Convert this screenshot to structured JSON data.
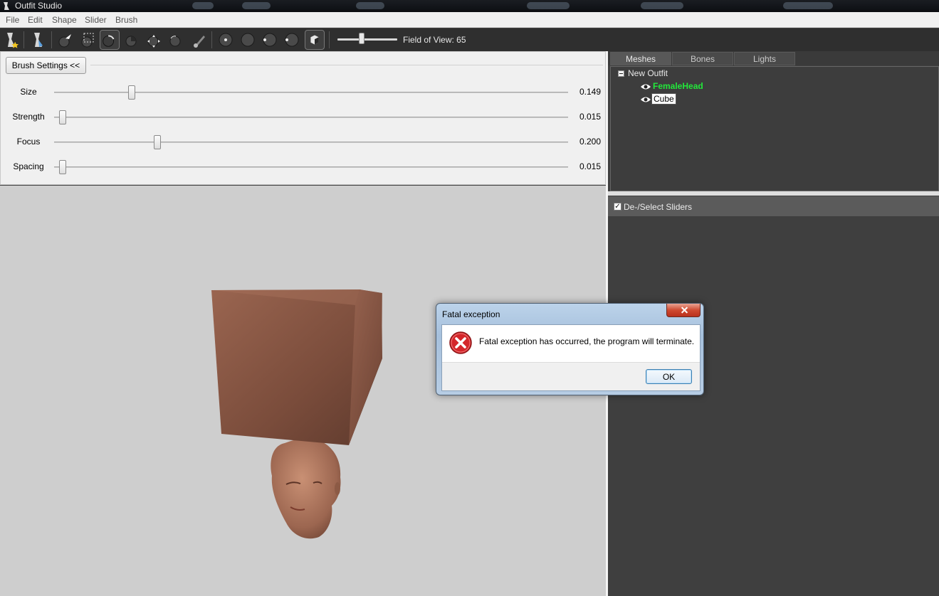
{
  "window": {
    "title": "Outfit Studio"
  },
  "menu": [
    "File",
    "Edit",
    "Shape",
    "Slider",
    "Brush"
  ],
  "toolbar": {
    "fov_label": "Field of View: 65",
    "fov_value": 65,
    "fov_range": [
      10,
      145
    ],
    "icons": [
      "new-project-icon",
      "load-outfit-icon",
      "select-brush-icon",
      "mask-brush-icon",
      "inflate-brush-icon",
      "deflate-brush-icon",
      "move-brush-icon",
      "smooth-brush-icon",
      "weight-brush-icon",
      "vertex-view-icon",
      "shaded-view-icon",
      "wireframe-view-icon",
      "lighting-view-icon",
      "textured-view-icon"
    ],
    "selected_tool": "inflate-brush-icon"
  },
  "brush_settings": {
    "button": "Brush Settings <<",
    "sliders": [
      {
        "label": "Size",
        "value": "0.149",
        "position": 0.149
      },
      {
        "label": "Strength",
        "value": "0.015",
        "position": 0.015
      },
      {
        "label": "Focus",
        "value": "0.200",
        "position": 0.2
      },
      {
        "label": "Spacing",
        "value": "0.015",
        "position": 0.015
      }
    ]
  },
  "tabs": [
    "Meshes",
    "Bones",
    "Lights"
  ],
  "active_tab": "Meshes",
  "tree": {
    "root": "New Outfit",
    "children": [
      "FemaleHead",
      "Cube"
    ],
    "colors": {
      "FemaleHead": "#22e83a",
      "Cube": "#000000"
    }
  },
  "sliders_header": {
    "checkbox_label": "De-/Select Sliders",
    "checked": true
  },
  "dialog": {
    "title": "Fatal exception",
    "message": "Fatal exception has occurred, the program will terminate.",
    "ok": "OK"
  },
  "colors": {
    "cube": "#8b5a46",
    "skin": "#b98064",
    "viewport": "#cecece",
    "panel": "#3f3f3f"
  }
}
